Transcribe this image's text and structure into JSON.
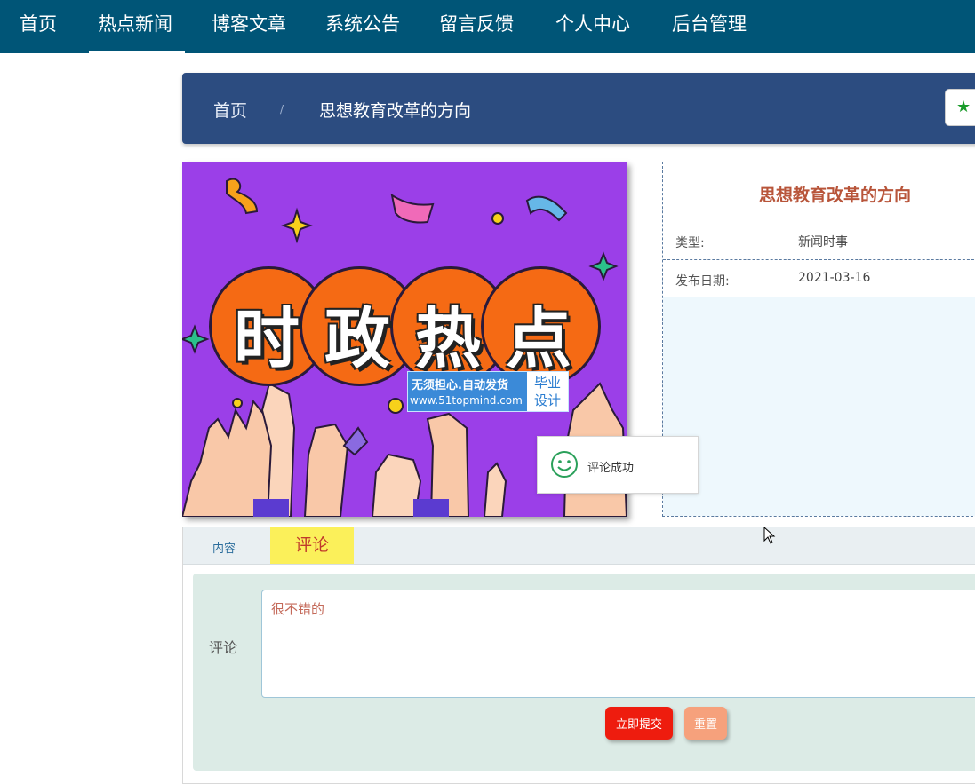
{
  "nav": {
    "items": [
      {
        "label": "首页"
      },
      {
        "label": "热点新闻"
      },
      {
        "label": "博客文章"
      },
      {
        "label": "系统公告"
      },
      {
        "label": "留言反馈"
      },
      {
        "label": "个人中心"
      },
      {
        "label": "后台管理"
      }
    ],
    "active_index": 1
  },
  "breadcrumb": {
    "home": "首页",
    "separator": "/",
    "current": "思想教育改革的方向"
  },
  "banner": {
    "chars": [
      "时",
      "政",
      "热",
      "点"
    ],
    "watermark_line1": "无须担心.自动发货",
    "watermark_line2": "www.51topmind.com",
    "watermark_badge_line1": "毕业",
    "watermark_badge_line2": "设计"
  },
  "info": {
    "title": "思想教育改革的方向",
    "rows": [
      {
        "label": "类型:",
        "value": "新闻时事"
      },
      {
        "label": "发布日期:",
        "value": "2021-03-16"
      }
    ]
  },
  "toast": {
    "icon": "smiley-icon",
    "message": "评论成功"
  },
  "tabs": {
    "content_label": "内容",
    "comment_label": "评论"
  },
  "comment_form": {
    "label": "评论",
    "value": "很不错的",
    "submit_label": "立即提交",
    "reset_label": "重置"
  },
  "colors": {
    "nav_bg": "#005577",
    "breadcrumb_bg": "#2c4c80",
    "banner_bg": "#9b3fe8",
    "title_color": "#b8553a",
    "submit_bg": "#ee1c0e",
    "reset_bg": "#f6a17c",
    "tab_active_bg": "#fbf05a"
  }
}
